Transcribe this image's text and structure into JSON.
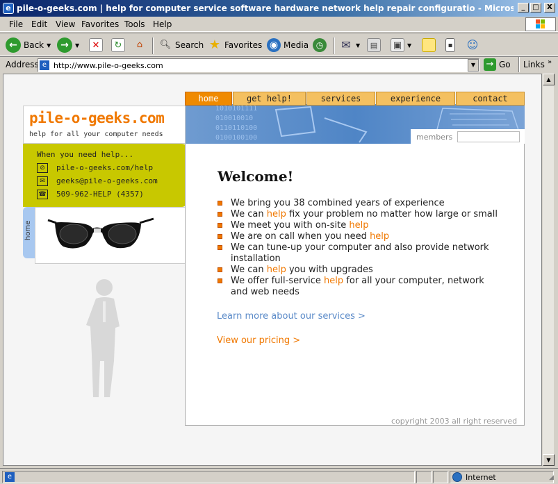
{
  "window": {
    "title": "pile-o-geeks.com | help for computer service software hardware network help repair configuratio - Microsoft Internet Explorer",
    "min": "_",
    "max": "□",
    "close": "X"
  },
  "menu": [
    "File",
    "Edit",
    "View",
    "Favorites",
    "Tools",
    "Help"
  ],
  "toolbar": {
    "back": "Back",
    "search": "Search",
    "favorites": "Favorites",
    "media": "Media"
  },
  "address": {
    "label": "Address",
    "url": "http://www.pile-o-geeks.com",
    "go": "Go",
    "links": "Links"
  },
  "site": {
    "logo": "pile-o-geeks.com",
    "tagline": "help for all your computer needs",
    "help_title": "When you need help...",
    "help_web": "pile-o-geeks.com/help",
    "help_email": "geeks@pile-o-geeks.com",
    "help_phone": "509-962-HELP (4357)",
    "side_tab": "home",
    "nav": [
      "home",
      "get help!",
      "services",
      "experience",
      "contact"
    ],
    "members_label": "members",
    "binary": [
      "1010101111",
      "010010010",
      "0110110100",
      "0100100100"
    ],
    "welcome": "Welcome!",
    "bullets": [
      [
        {
          "t": "We bring you 38 combined years of experience"
        }
      ],
      [
        {
          "t": "We can "
        },
        {
          "t": "help",
          "o": true
        },
        {
          "t": " fix your problem no matter how large or small"
        }
      ],
      [
        {
          "t": "We meet you with on-site "
        },
        {
          "t": "help",
          "o": true
        }
      ],
      [
        {
          "t": "We are on call when you need "
        },
        {
          "t": "help",
          "o": true
        }
      ],
      [
        {
          "t": "We can tune-up your computer and also provide network"
        }
      ],
      [
        {
          "t": "installation"
        }
      ],
      [
        {
          "t": "We can "
        },
        {
          "t": "help",
          "o": true
        },
        {
          "t": " you with upgrades"
        }
      ],
      [
        {
          "t": "We offer full-service "
        },
        {
          "t": "help",
          "o": true
        },
        {
          "t": " for all your computer, network"
        }
      ],
      [
        {
          "t": "and web needs"
        }
      ]
    ],
    "learn_more": "Learn more about our services >",
    "pricing": "View our pricing >",
    "copyright": "copyright 2003 all right reserved"
  },
  "status": {
    "zone": "Internet"
  },
  "colors": {
    "accent": "#f07800",
    "help_box": "#c8c800",
    "header_blue": "#4f85c6",
    "link_blue": "#5a8ac8"
  }
}
